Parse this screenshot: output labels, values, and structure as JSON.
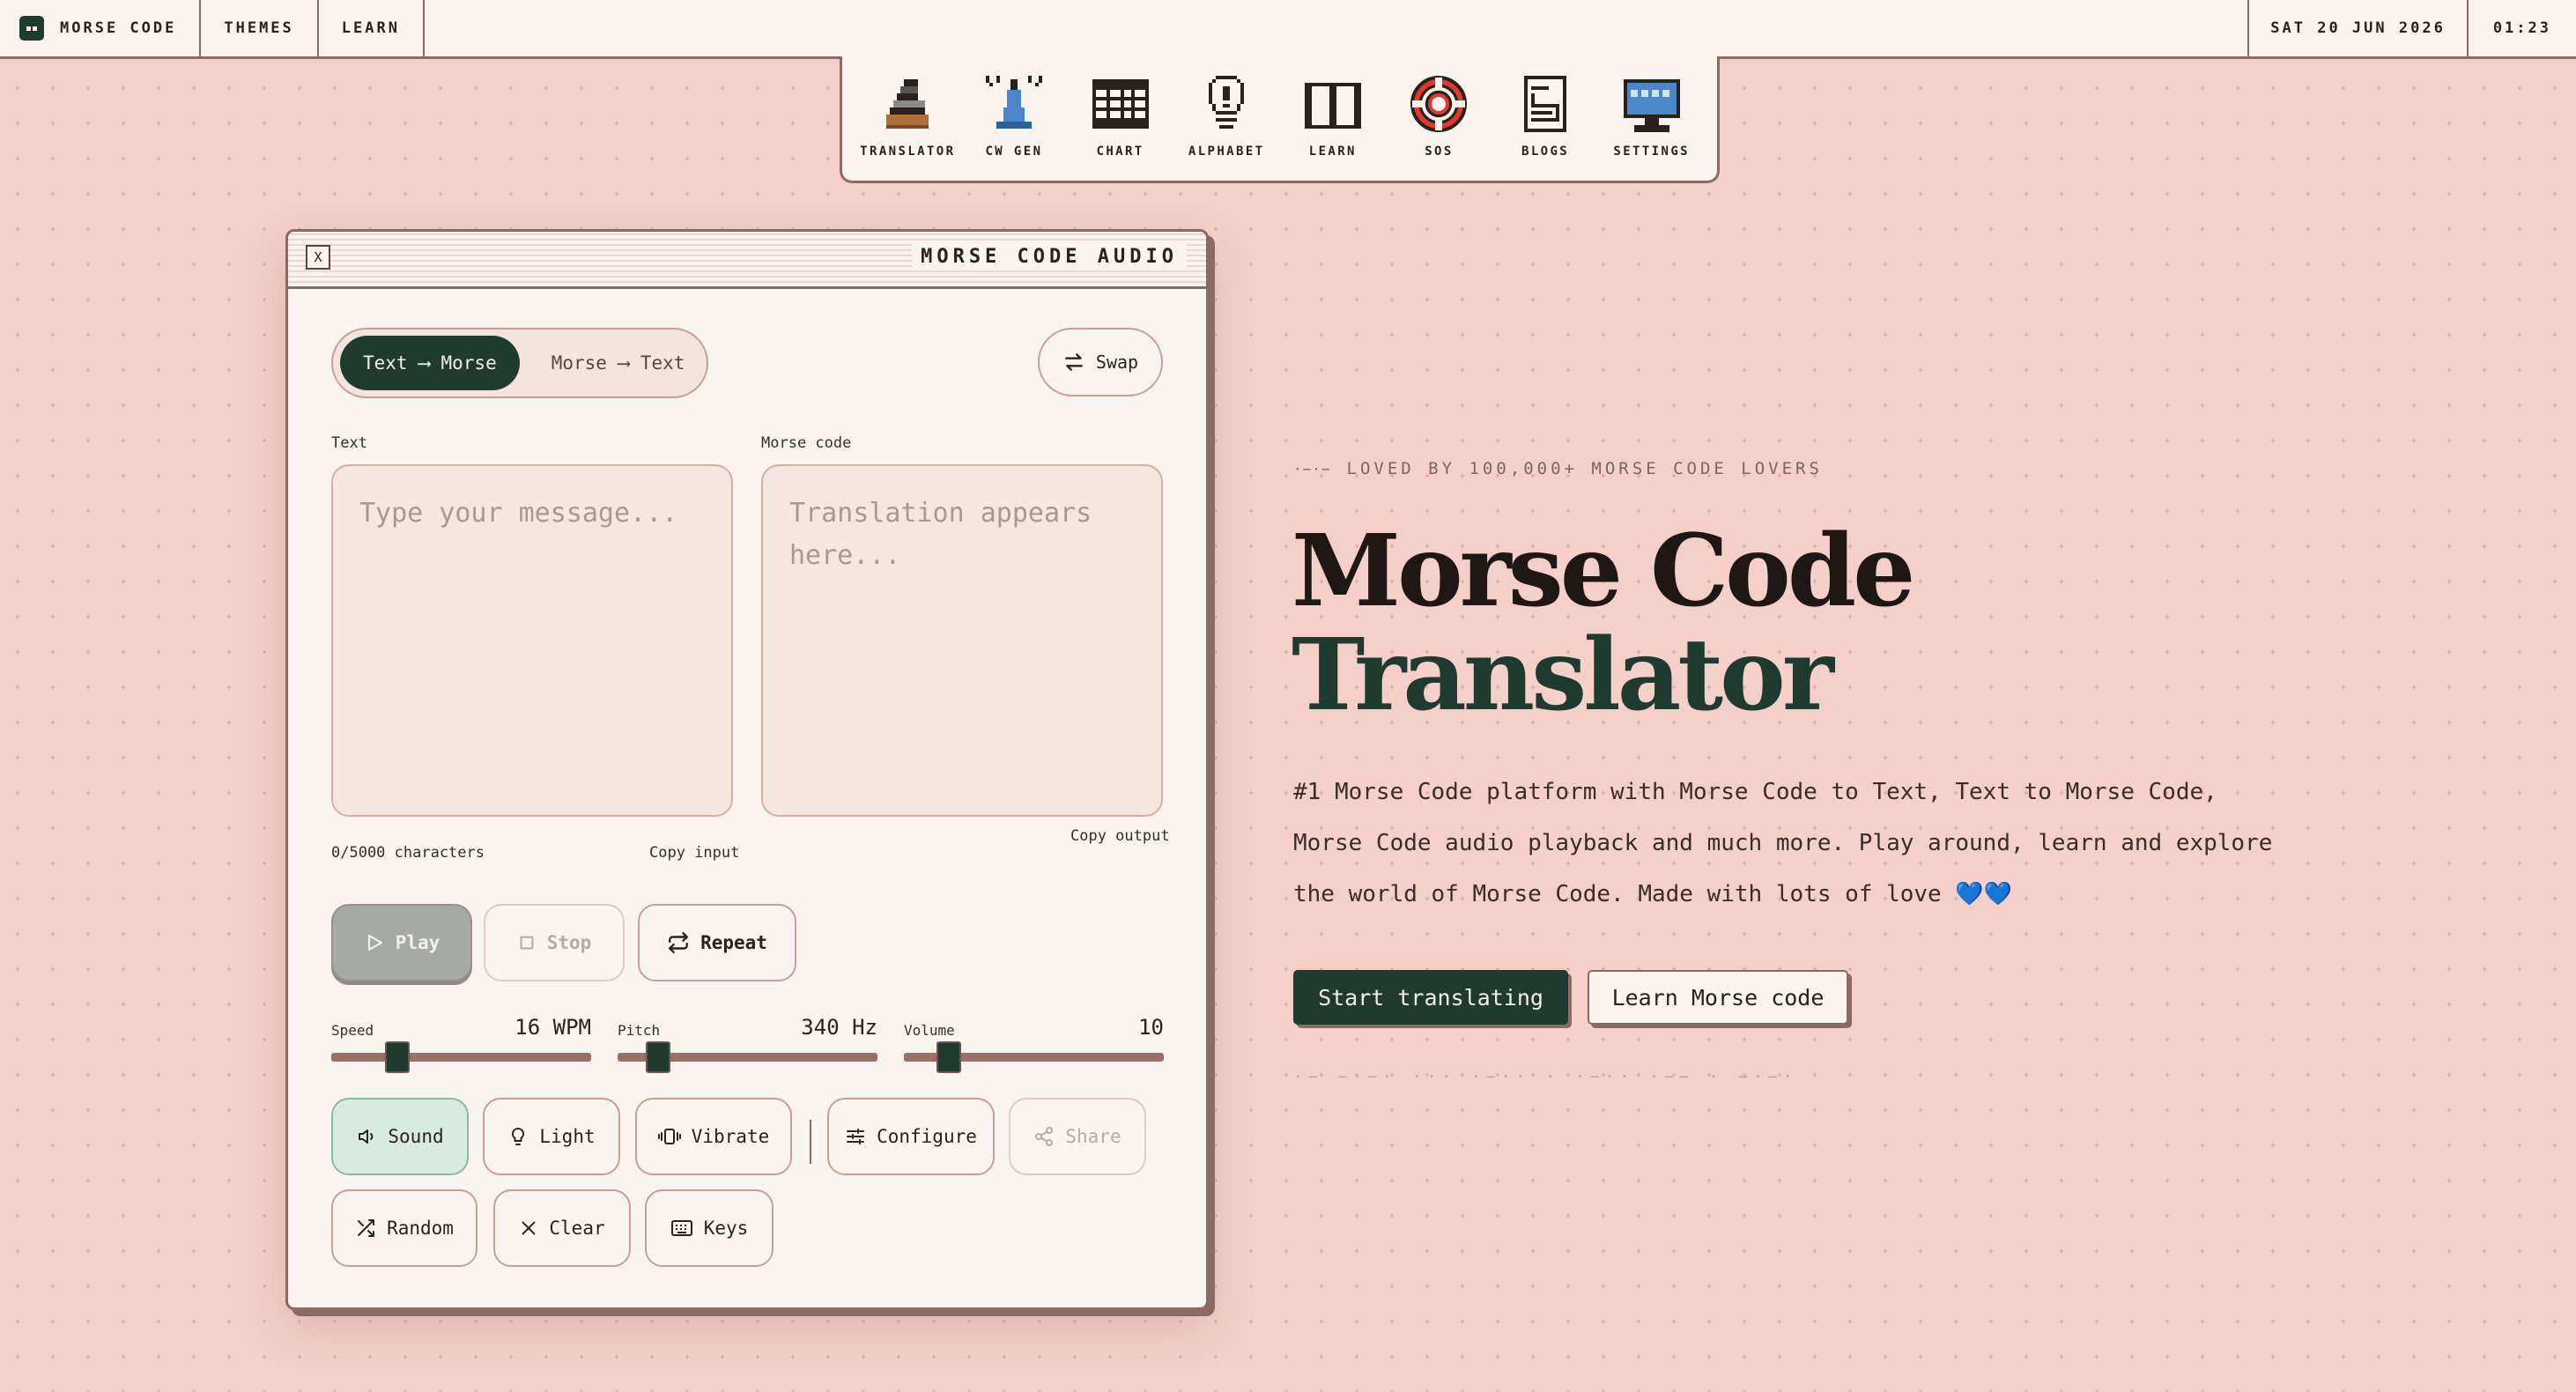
{
  "topbar": {
    "brand": "MORSE CODE",
    "nav": [
      "THEMES",
      "LEARN"
    ],
    "date": "SAT 20 JUN 2026",
    "time": "01:23"
  },
  "dock": {
    "items": [
      {
        "label": "TRANSLATOR",
        "icon": "telegraph-key-icon"
      },
      {
        "label": "CW GEN",
        "icon": "antenna-icon"
      },
      {
        "label": "CHART",
        "icon": "grid-chart-icon"
      },
      {
        "label": "ALPHABET",
        "icon": "lightbulb-icon"
      },
      {
        "label": "LEARN",
        "icon": "open-book-icon"
      },
      {
        "label": "SOS",
        "icon": "lifebuoy-icon"
      },
      {
        "label": "BLOGS",
        "icon": "document-icon"
      },
      {
        "label": "SETTINGS",
        "icon": "monitor-icon"
      }
    ]
  },
  "window": {
    "title": "MORSE CODE AUDIO",
    "close_label": "X",
    "mode": {
      "active": "Text ⟶ Morse",
      "inactive": "Morse ⟶ Text"
    },
    "swap_label": "Swap",
    "input": {
      "label": "Text",
      "placeholder": "Type your message...",
      "char_count": "0/5000 characters",
      "copy_label": "Copy input"
    },
    "output": {
      "label": "Morse code",
      "placeholder": "Translation appears here...",
      "copy_label": "Copy output"
    },
    "playback": {
      "play": "Play",
      "stop": "Stop",
      "repeat": "Repeat"
    },
    "sliders": {
      "speed": {
        "label": "Speed",
        "value": "16 WPM",
        "level": 0.23
      },
      "pitch": {
        "label": "Pitch",
        "value": "340 Hz",
        "level": 0.12
      },
      "volume": {
        "label": "Volume",
        "value": "10",
        "level": 0.14
      }
    },
    "toggles": {
      "sound": "Sound",
      "light": "Light",
      "vibrate": "Vibrate"
    },
    "actions": {
      "configure": "Configure",
      "share": "Share",
      "random": "Random",
      "clear": "Clear",
      "keys": "Keys"
    }
  },
  "hero": {
    "eyebrow_mark": "·−·−",
    "eyebrow": "LOVED BY 100,000+ MORSE CODE LOVERS",
    "title_line1": "Morse Code",
    "title_line2": "Translator",
    "description": "#1 Morse Code platform with Morse Code to Text, Text to Morse Code, Morse Code audio playback and much more. Play around, learn and explore the world of Morse Code. Made with lots of love 💙💙",
    "primary_cta": "Start translating",
    "secondary_cta": "Learn Morse code",
    "morse_line": "·− −·−· ··· ·−·· · ·−·· ·−− · −·−·"
  },
  "colors": {
    "accent": "#1f3a2e",
    "background": "#f4d0c8",
    "border": "#8a6a63",
    "panel": "#faf4f1"
  }
}
